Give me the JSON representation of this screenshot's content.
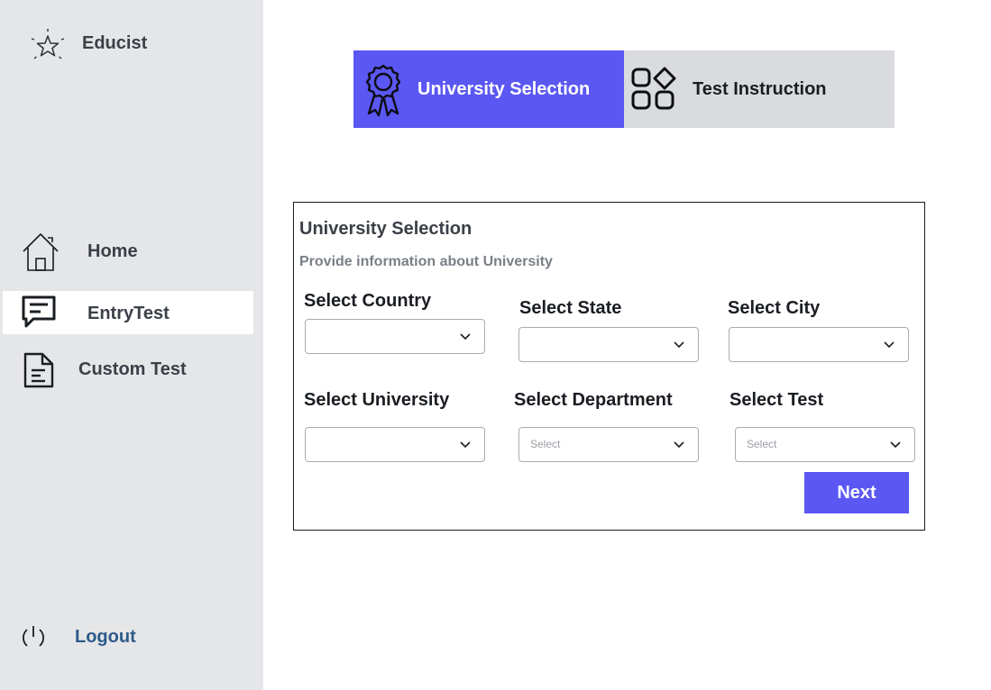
{
  "sidebar": {
    "brand": "Educist",
    "nav": [
      {
        "label": "Home",
        "icon": "home-icon"
      },
      {
        "label": "EntryTest",
        "icon": "message-icon"
      },
      {
        "label": "Custom Test",
        "icon": "document-icon"
      }
    ],
    "logout": "Logout"
  },
  "stepper": {
    "steps": [
      {
        "label": "University Selection",
        "icon": "badge-icon"
      },
      {
        "label": "Test Instruction",
        "icon": "grid-icon"
      }
    ]
  },
  "form": {
    "title": "University Selection",
    "subtitle": "Provide information about University",
    "fields": [
      {
        "label": "Select Country",
        "value": ""
      },
      {
        "label": "Select State",
        "value": ""
      },
      {
        "label": "Select City",
        "value": ""
      },
      {
        "label": "Select University",
        "value": ""
      },
      {
        "label": "Select Department",
        "value": "Select"
      },
      {
        "label": "Select Test",
        "value": "Select"
      }
    ],
    "next_label": "Next"
  },
  "colors": {
    "accent": "#5b57f2",
    "sidebar_bg": "#e5e6e8",
    "logout_text": "#2e5a8c"
  }
}
